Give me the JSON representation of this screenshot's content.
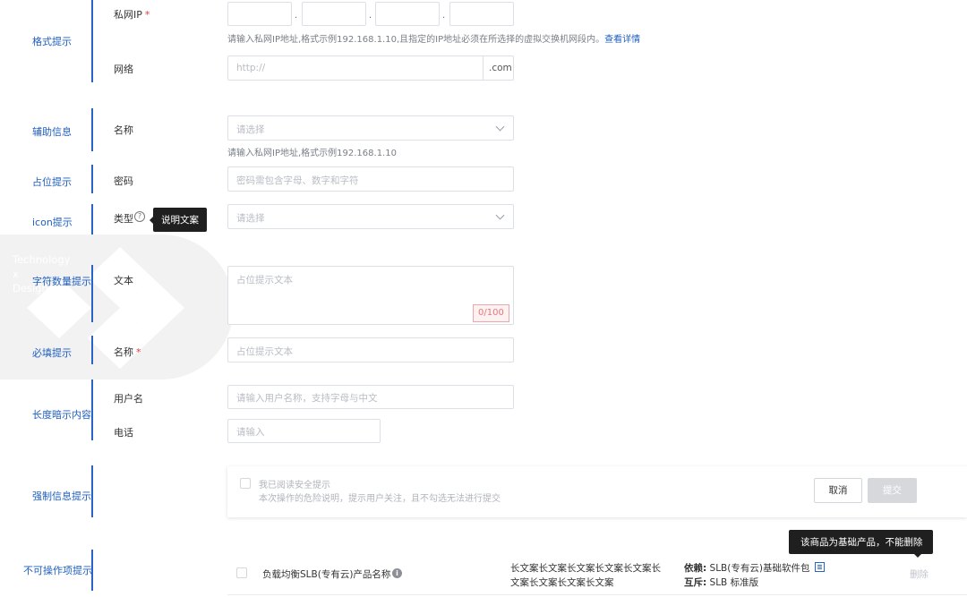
{
  "sections": {
    "format_hint": "格式提示",
    "aux_info": "辅助信息",
    "placeholder_hint": "占位提示",
    "icon_hint": "icon提示",
    "char_count_hint": "字符数量提示",
    "required_hint": "必填提示",
    "length_hint": "长度暗示内容",
    "force_info_hint": "强制信息提示",
    "disabled_item_hint": "不可操作项提示"
  },
  "watermark": {
    "line1": "Technology",
    "line2": "x",
    "line3": "Design"
  },
  "private_ip": {
    "label": "私网IP",
    "required_mark": "*",
    "dot": ".",
    "hint_prefix": "请输入私网IP地址,格式示例192.168.1.10,且指定的IP地址必须在所选择的虚拟交换机网段内。",
    "hint_link": "查看详情"
  },
  "network": {
    "label": "网络",
    "placeholder": "http://",
    "suffix": ".com"
  },
  "name_select": {
    "label": "名称",
    "placeholder": "请选择",
    "hint": "请输入私网IP地址,格式示例192.168.1.10"
  },
  "password": {
    "label": "密码",
    "placeholder": "密码需包含字母、数字和字符"
  },
  "type_select": {
    "label": "类型",
    "help_icon_glyph": "?",
    "tooltip": "说明文案",
    "placeholder": "请选择"
  },
  "text_area": {
    "label": "文本",
    "placeholder": "占位提示文本",
    "counter": "0/100"
  },
  "required_name": {
    "label": "名称",
    "required_mark": "*",
    "placeholder": "占位提示文本"
  },
  "username": {
    "label": "用户名",
    "placeholder": "请输入用户名称，支持字母与中文"
  },
  "phone": {
    "label": "电话",
    "placeholder": "请输入"
  },
  "agreement": {
    "checkbox_label": "我已阅读安全提示",
    "description": "本次操作的危险说明，提示用户关注，且不勾选无法进行提交",
    "cancel": "取消",
    "submit": "提交"
  },
  "product_row": {
    "tooltip": "该商品为基础产品，不能删除",
    "product_name": "负载均衡SLB(专有云)产品名称",
    "info_icon_glyph": "i",
    "long_text_1": "长文案长文案长文案长文案长文案长",
    "long_text_2": "文案长文案长文案长文案",
    "dep_label": "依赖:",
    "dep_value": "SLB(专有云)基础软件包",
    "mutex_label": "互斥:",
    "mutex_value": "SLB 标准版",
    "delete": "删除"
  },
  "colors": {
    "accent": "#1f5fbf",
    "bar": "#2a63c7",
    "required": "#e23b3b",
    "tooltip_bg": "#1f1f1f",
    "counter": "#e0797c"
  }
}
